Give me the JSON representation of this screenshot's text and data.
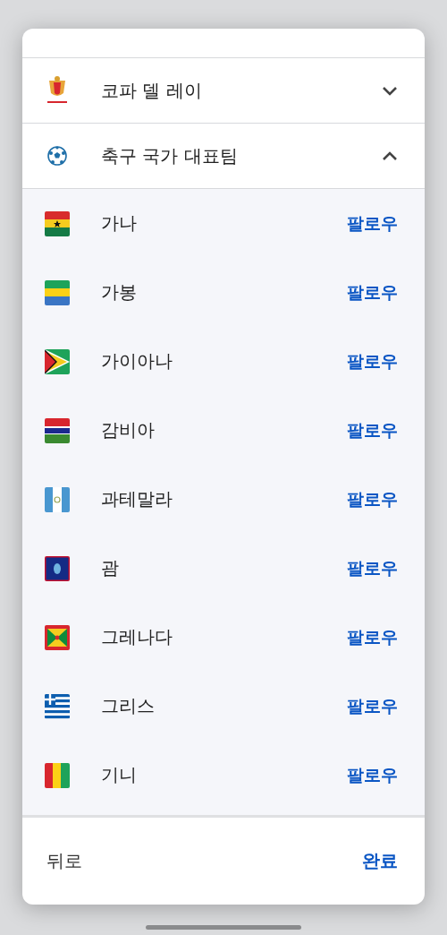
{
  "sections": [
    {
      "kind": "cup",
      "title": "코파 델 레이",
      "expanded": false
    },
    {
      "kind": "ball",
      "title": "축구 국가 대표팀",
      "expanded": true
    }
  ],
  "teams": [
    {
      "kind": "ghana",
      "name": "가나",
      "action": "팔로우"
    },
    {
      "kind": "gabon",
      "name": "가봉",
      "action": "팔로우"
    },
    {
      "kind": "guyana",
      "name": "가이아나",
      "action": "팔로우"
    },
    {
      "kind": "gambia",
      "name": "감비아",
      "action": "팔로우"
    },
    {
      "kind": "guatemala",
      "name": "과테말라",
      "action": "팔로우"
    },
    {
      "kind": "guam",
      "name": "괌",
      "action": "팔로우"
    },
    {
      "kind": "grenada",
      "name": "그레나다",
      "action": "팔로우"
    },
    {
      "kind": "greece",
      "name": "그리스",
      "action": "팔로우"
    },
    {
      "kind": "guinea",
      "name": "기니",
      "action": "팔로우"
    }
  ],
  "footer": {
    "back": "뒤로",
    "done": "완료"
  }
}
